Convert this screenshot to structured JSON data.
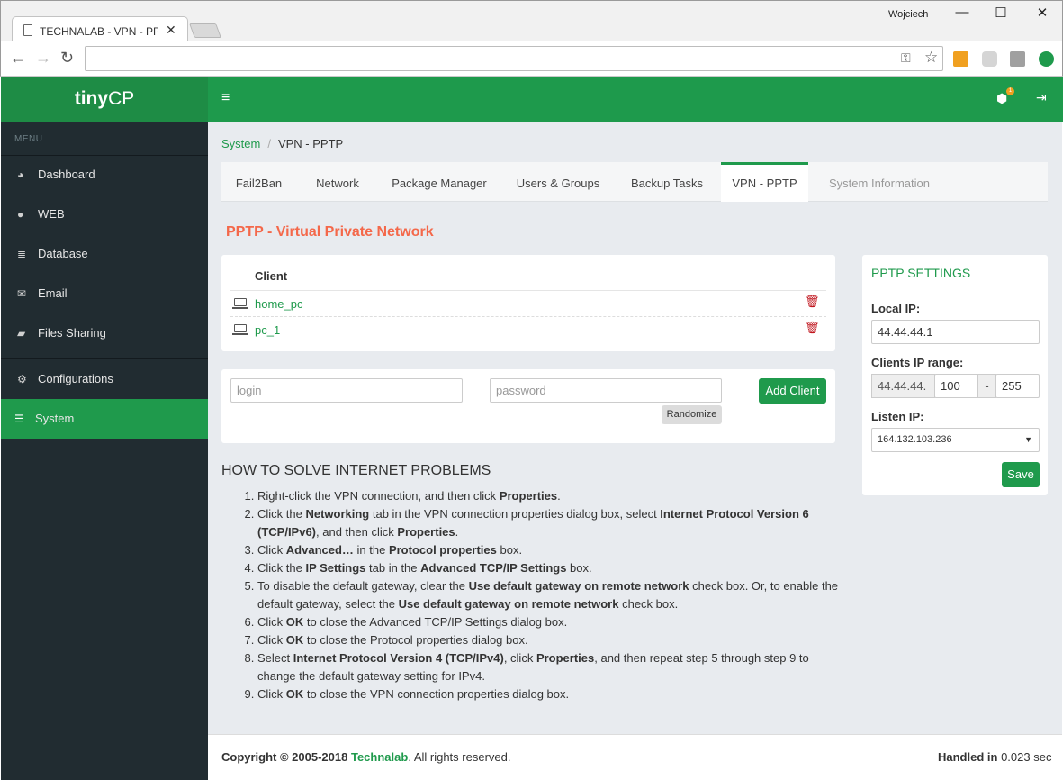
{
  "browser": {
    "tab_title": "TECHNALAB - VPN - PPTP",
    "user": "Wojciech",
    "address_value": ""
  },
  "app": {
    "logo_bold": "tiny",
    "logo_rest": "CP",
    "menu_header": "MENU",
    "menu": [
      {
        "label": "Dashboard",
        "icon": "tachometer-icon"
      },
      {
        "label": "WEB",
        "icon": "globe-icon"
      },
      {
        "label": "Database",
        "icon": "database-icon"
      },
      {
        "label": "Email",
        "icon": "envelope-icon"
      },
      {
        "label": "Files Sharing",
        "icon": "folder-open-icon"
      },
      {
        "label": "Configurations",
        "icon": "cog-icon"
      },
      {
        "label": "System",
        "icon": "tasks-icon",
        "active": true
      }
    ],
    "notify_count": "1",
    "accent": "#1f9a4c"
  },
  "breadcrumb": {
    "parent": "System",
    "separator": "/",
    "current": "VPN - PPTP"
  },
  "tabs": [
    {
      "label": "Fail2Ban"
    },
    {
      "label": "Network"
    },
    {
      "label": "Package Manager"
    },
    {
      "label": "Users & Groups"
    },
    {
      "label": "Backup Tasks"
    },
    {
      "label": "VPN - PPTP",
      "active": true
    },
    {
      "label": "System Information",
      "disabled": true
    }
  ],
  "page_title": "PPTP - Virtual Private Network",
  "clients": {
    "header": "Client",
    "rows": [
      {
        "name": "home_pc"
      },
      {
        "name": "pc_1"
      }
    ]
  },
  "add_form": {
    "login_placeholder": "login",
    "password_placeholder": "password",
    "randomize_label": "Randomize",
    "add_label": "Add Client"
  },
  "howto": {
    "title": "HOW TO SOLVE INTERNET PROBLEMS",
    "steps": [
      "Right-click the VPN connection, and then click <b>Properties</b>.",
      "Click the <b>Networking</b> tab in the VPN connection properties dialog box, select <b>Internet Protocol Version 6 (TCP/IPv6)</b>, and then click <b>Properties</b>.",
      "Click <b>Advanced…</b> in the <b>Protocol properties</b> box.",
      "Click the <b>IP Settings</b> tab in the <b>Advanced TCP/IP Settings</b> box.",
      "To disable the default gateway, clear the <b>Use default gateway on remote network</b> check box. Or, to enable the default gateway, select the <b>Use default gateway on remote network</b> check box.",
      "Click <b>OK</b> to close the Advanced TCP/IP Settings dialog box.",
      "Click <b>OK</b> to close the Protocol properties dialog box.",
      "Select <b>Internet Protocol Version 4 (TCP/IPv4)</b>, click <b>Properties</b>, and then repeat step 5 through step 9 to change the default gateway setting for IPv4.",
      "Click <b>OK</b> to close the VPN connection properties dialog box."
    ]
  },
  "settings": {
    "title": "PPTP SETTINGS",
    "local_ip_label": "Local IP:",
    "local_ip": "44.44.44.1",
    "range_label": "Clients IP range:",
    "range_prefix": "44.44.44.",
    "range_start": "100",
    "range_dash": "-",
    "range_end": "255",
    "listen_label": "Listen IP:",
    "listen_ip": "164.132.103.236",
    "save_label": "Save"
  },
  "footer": {
    "copyright_prefix": "Copyright © 2005-2018 ",
    "company": "Technalab",
    "copyright_suffix": ". All rights reserved.",
    "handled_label": "Handled in",
    "handled_value": " 0.023 sec"
  }
}
